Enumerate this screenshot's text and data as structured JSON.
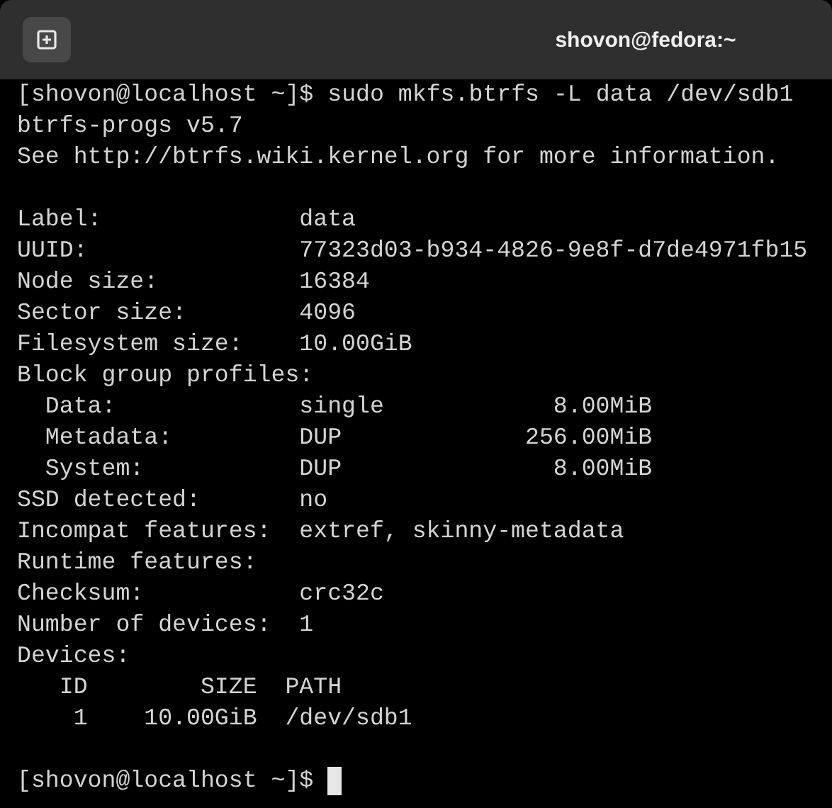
{
  "window": {
    "title": "shovon@fedora:~"
  },
  "terminal": {
    "lines": [
      {
        "kind": "prompt",
        "prompt": "[shovon@localhost ~]$",
        "command": "sudo mkfs.btrfs -L data /dev/sdb1"
      },
      {
        "kind": "output",
        "text": "btrfs-progs v5.7"
      },
      {
        "kind": "output",
        "text": "See http://btrfs.wiki.kernel.org for more information."
      },
      {
        "kind": "blank"
      },
      {
        "kind": "output",
        "text": "Label:              data"
      },
      {
        "kind": "output",
        "text": "UUID:               77323d03-b934-4826-9e8f-d7de4971fb15"
      },
      {
        "kind": "output",
        "text": "Node size:          16384"
      },
      {
        "kind": "output",
        "text": "Sector size:        4096"
      },
      {
        "kind": "output",
        "text": "Filesystem size:    10.00GiB"
      },
      {
        "kind": "output",
        "text": "Block group profiles:"
      },
      {
        "kind": "output",
        "text": "  Data:             single            8.00MiB"
      },
      {
        "kind": "output",
        "text": "  Metadata:         DUP             256.00MiB"
      },
      {
        "kind": "output",
        "text": "  System:           DUP               8.00MiB"
      },
      {
        "kind": "output",
        "text": "SSD detected:       no"
      },
      {
        "kind": "output",
        "text": "Incompat features:  extref, skinny-metadata"
      },
      {
        "kind": "output",
        "text": "Runtime features:"
      },
      {
        "kind": "output",
        "text": "Checksum:           crc32c"
      },
      {
        "kind": "output",
        "text": "Number of devices:  1"
      },
      {
        "kind": "output",
        "text": "Devices:"
      },
      {
        "kind": "output",
        "text": "   ID        SIZE  PATH"
      },
      {
        "kind": "output",
        "text": "    1    10.00GiB  /dev/sdb1"
      },
      {
        "kind": "blank"
      },
      {
        "kind": "prompt",
        "prompt": "[shovon@localhost ~]$",
        "cursor": true
      }
    ]
  }
}
